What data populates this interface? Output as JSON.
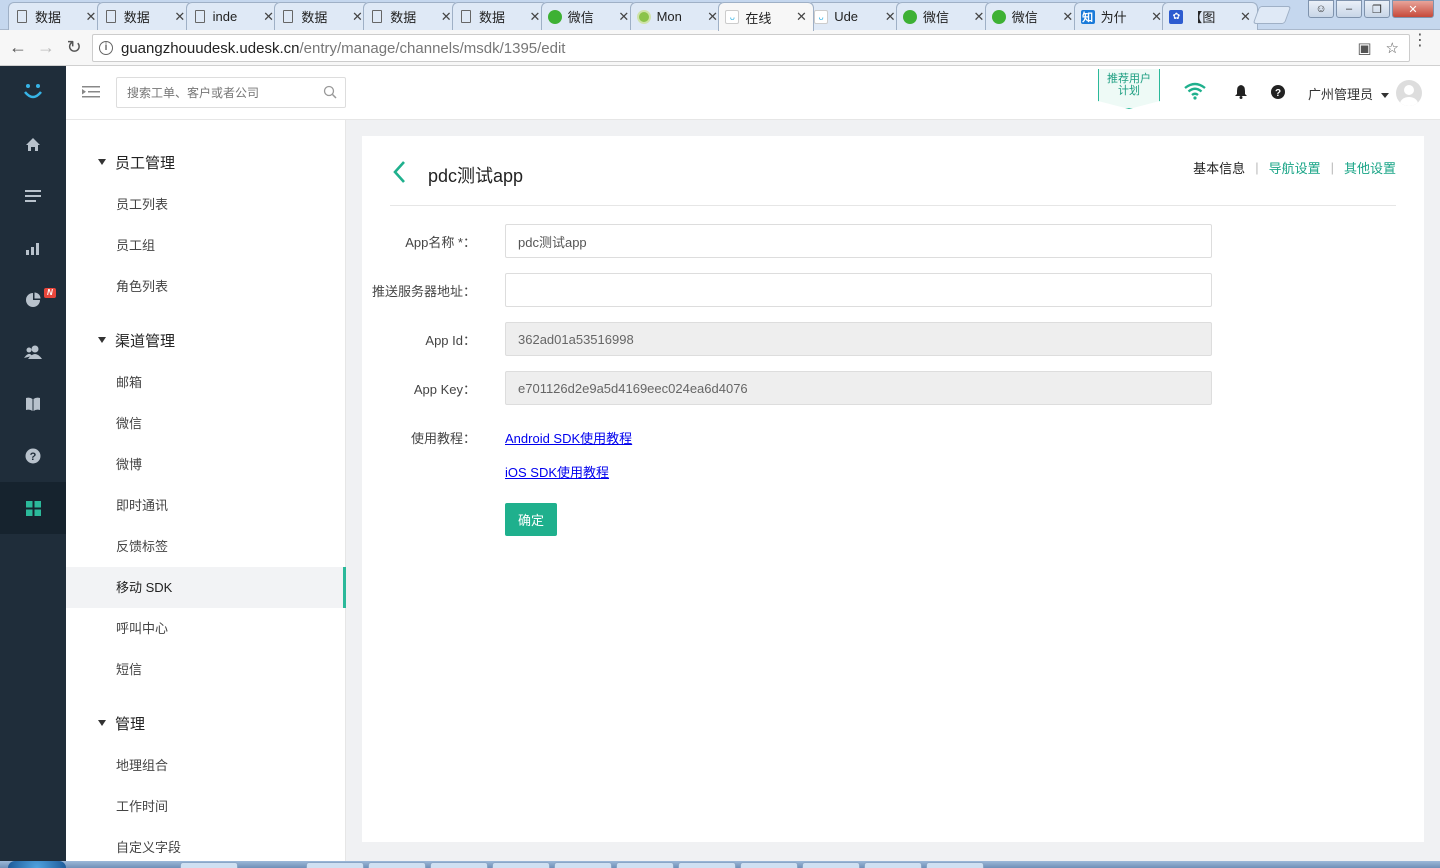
{
  "browser": {
    "tabs": [
      {
        "label": "数据",
        "icon": "doc"
      },
      {
        "label": "数据",
        "icon": "doc"
      },
      {
        "label": "inde",
        "icon": "doc"
      },
      {
        "label": "数据",
        "icon": "doc"
      },
      {
        "label": "数据",
        "icon": "doc"
      },
      {
        "label": "数据",
        "icon": "doc"
      },
      {
        "label": "微信",
        "icon": "wechat"
      },
      {
        "label": "Mon",
        "icon": "mon"
      },
      {
        "label": "在线",
        "icon": "udesk",
        "active": true
      },
      {
        "label": "Ude",
        "icon": "udesk"
      },
      {
        "label": "微信",
        "icon": "wechat"
      },
      {
        "label": "微信",
        "icon": "wechat"
      },
      {
        "label": "为什",
        "icon": "zhi"
      },
      {
        "label": "【图",
        "icon": "baidu"
      }
    ],
    "url_host": "guangzhouudesk.udesk.cn",
    "url_path": "/entry/manage/channels/msdk/1395/edit"
  },
  "header": {
    "search_placeholder": "搜索工单、客户或者公司",
    "promo_line1": "推荐用户",
    "promo_line2": "计划",
    "user_name": "广州管理员"
  },
  "rail": {
    "items": [
      "home-icon",
      "list-icon",
      "bar-chart-icon",
      "pie-chart-icon",
      "users-icon",
      "book-icon",
      "help-icon",
      "apps-icon"
    ],
    "badge": "N",
    "accent": "#2bb99a"
  },
  "sidenav": {
    "groups": [
      {
        "title": "员工管理",
        "items": [
          "员工列表",
          "员工组",
          "角色列表"
        ]
      },
      {
        "title": "渠道管理",
        "items": [
          "邮箱",
          "微信",
          "微博",
          "即时通讯",
          "反馈标签",
          "移动 SDK",
          "呼叫中心",
          "短信"
        ]
      },
      {
        "title": "管理",
        "items": [
          "地理组合",
          "工作时间",
          "自定义字段"
        ]
      }
    ],
    "active_item": "移动 SDK"
  },
  "page": {
    "title": "pdc测试app",
    "tabs": [
      {
        "label": "基本信息",
        "current": true
      },
      {
        "label": "导航设置",
        "current": false
      },
      {
        "label": "其他设置",
        "current": false
      }
    ]
  },
  "form": {
    "app_name": {
      "label": "App名称 *：",
      "value": "pdc测试app"
    },
    "push_server": {
      "label": "推送服务器地址：",
      "value": ""
    },
    "app_id": {
      "label": "App Id：",
      "value": "362ad01a53516998"
    },
    "app_key": {
      "label": "App Key：",
      "value": "e701126d2e9a5d4169eec024ea6d4076"
    },
    "tutorial": {
      "label": "使用教程：",
      "android_link": "Android SDK使用教程",
      "ios_link": "iOS SDK使用教程"
    },
    "submit_label": "确定"
  }
}
